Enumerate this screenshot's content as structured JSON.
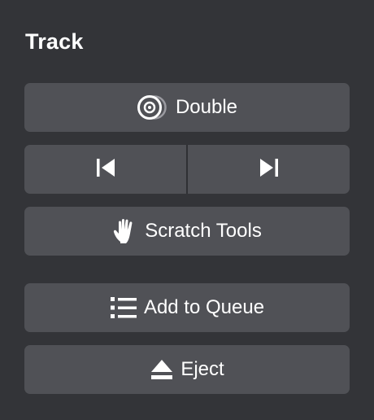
{
  "panel": {
    "title": "Track"
  },
  "buttons": {
    "double": {
      "label": "Double",
      "icon": "double-disc-icon"
    },
    "previous": {
      "icon": "skip-previous-icon"
    },
    "next": {
      "icon": "skip-next-icon"
    },
    "scratch": {
      "label": "Scratch Tools",
      "icon": "hand-icon"
    },
    "queue": {
      "label": "Add to Queue",
      "icon": "list-icon"
    },
    "eject": {
      "label": "Eject",
      "icon": "eject-icon"
    }
  },
  "colors": {
    "background": "#333438",
    "button": "#505156",
    "text": "#ffffff"
  }
}
